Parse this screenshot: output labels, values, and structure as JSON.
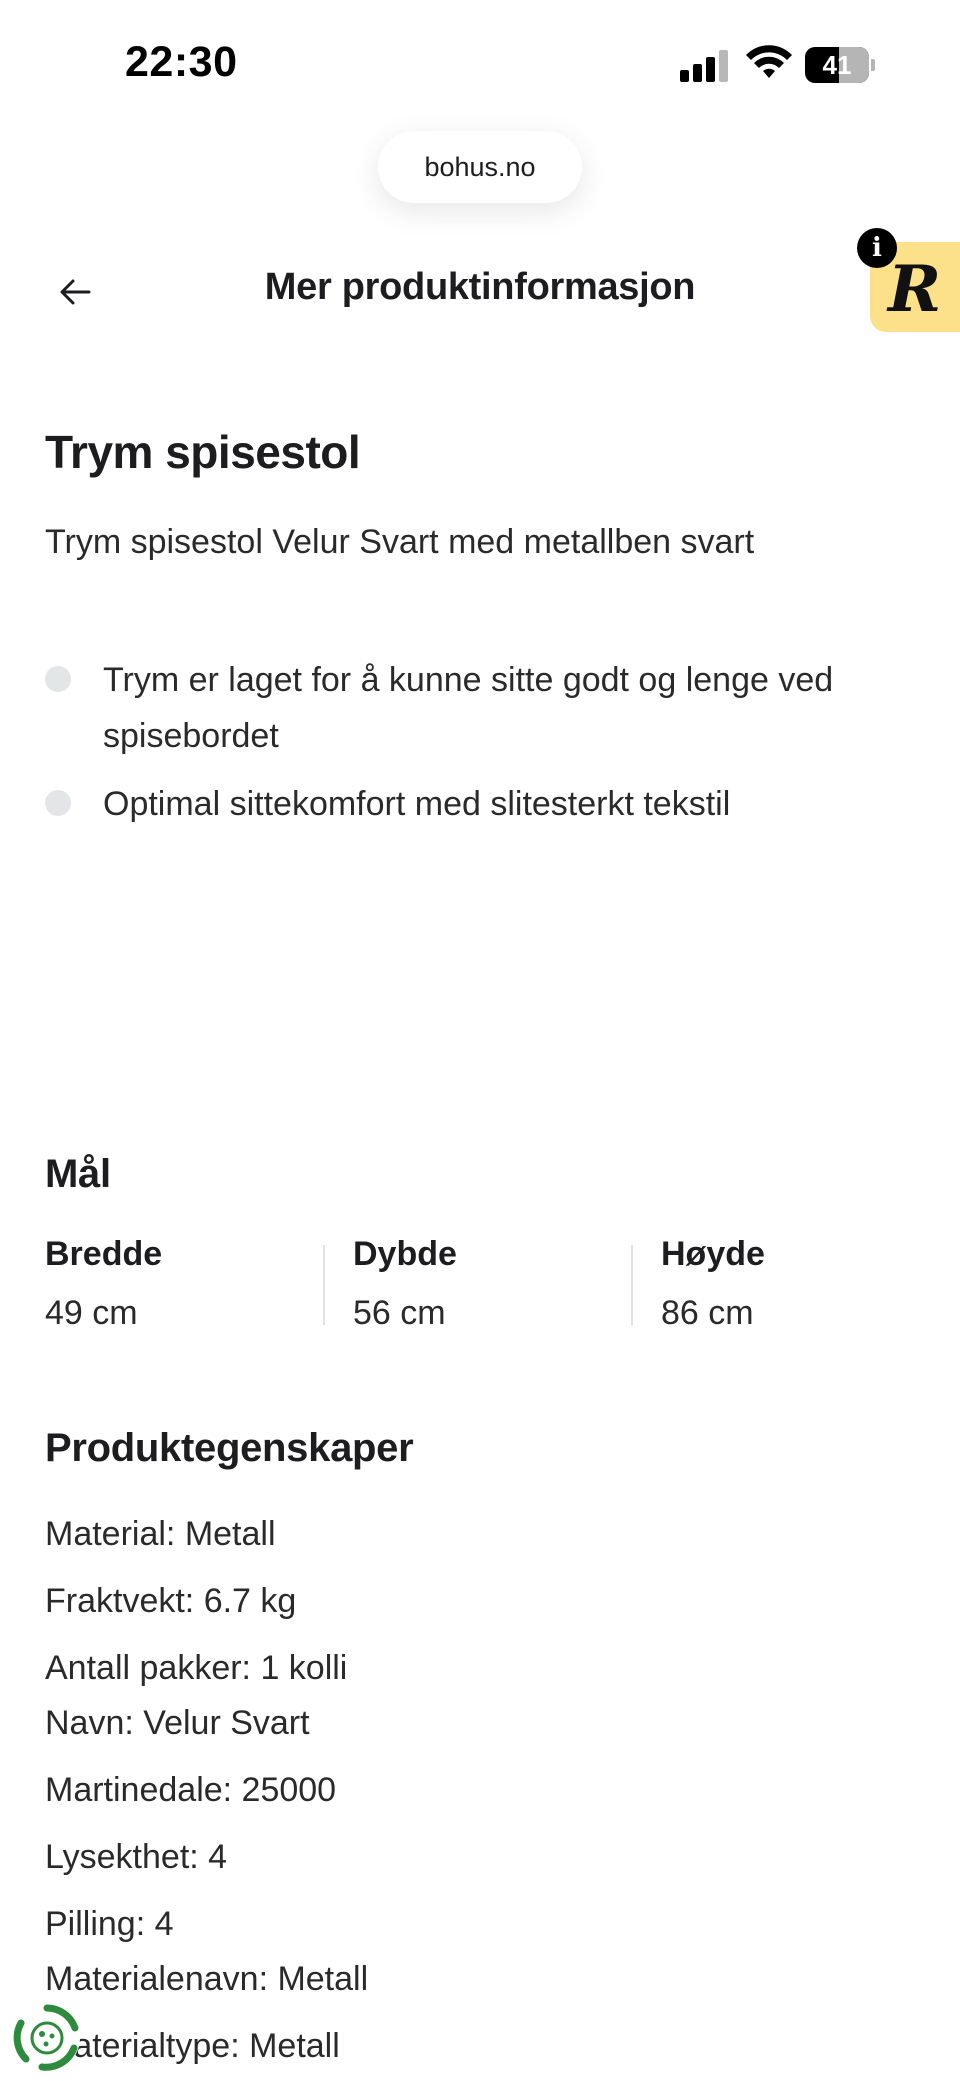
{
  "status_bar": {
    "time": "22:30",
    "battery": "41"
  },
  "browser": {
    "url": "bohus.no"
  },
  "header": {
    "title": "Mer produktinformasjon"
  },
  "product": {
    "title": "Trym spisestol",
    "description": "Trym spisestol Velur Svart med metallben svart",
    "bullets": [
      "Trym er laget for å kunne sitte godt og lenge ved spisebordet",
      "Optimal sittekomfort med slitesterkt tekstil"
    ]
  },
  "dimensions": {
    "title": "Mål",
    "items": [
      {
        "label": "Bredde",
        "value": "49 cm"
      },
      {
        "label": "Dybde",
        "value": "56 cm"
      },
      {
        "label": "Høyde",
        "value": "86 cm"
      }
    ]
  },
  "properties": {
    "title": "Produktegenskaper",
    "items": [
      "Material: Metall",
      "Fraktvekt: 6.7 kg",
      "Antall pakker: 1 kolli",
      "Navn: Velur Svart",
      "Martinedale: 25000",
      "Lysekthet: 4",
      "Pilling: 4",
      "Materialenavn: Metall",
      "Materialtype: Metall"
    ]
  },
  "icons": {
    "back": "arrow-left-icon",
    "info": "info-icon",
    "brand": "brand-r-logo",
    "cookie": "cookie-settings-icon"
  },
  "colors": {
    "badge": "#fde08a",
    "bullet": "#e3e6e6",
    "cookie": "#2e8b3e"
  }
}
